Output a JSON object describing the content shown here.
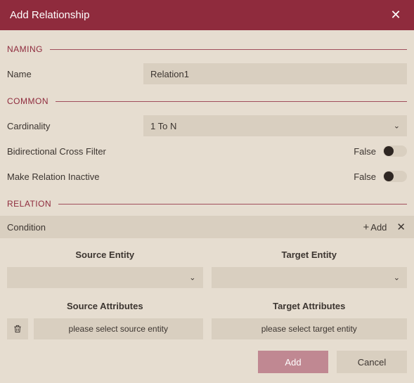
{
  "title": "Add Relationship",
  "sections": {
    "naming": "NAMING",
    "common": "COMMON",
    "relation": "RELATION"
  },
  "naming": {
    "name_label": "Name",
    "name_value": "Relation1"
  },
  "common": {
    "cardinality_label": "Cardinality",
    "cardinality_value": "1 To N",
    "bidi_label": "Bidirectional Cross Filter",
    "bidi_value": "False",
    "inactive_label": "Make Relation Inactive",
    "inactive_value": "False"
  },
  "condition": {
    "label": "Condition",
    "add_label": "Add"
  },
  "grid": {
    "source_entity_label": "Source Entity",
    "target_entity_label": "Target Entity",
    "source_attr_label": "Source Attributes",
    "target_attr_label": "Target Attributes",
    "source_attr_placeholder": "please select source entity",
    "target_attr_placeholder": "please select target entity"
  },
  "footer": {
    "add": "Add",
    "cancel": "Cancel"
  }
}
